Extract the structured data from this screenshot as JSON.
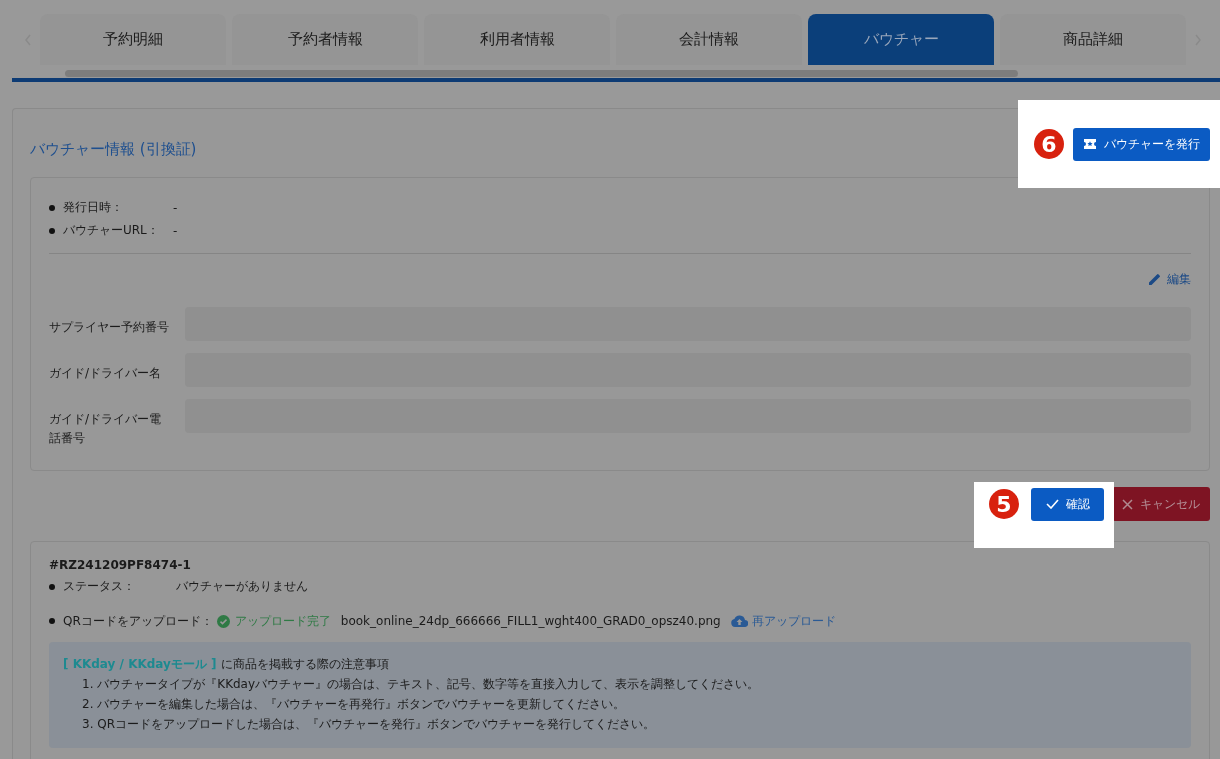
{
  "tabs": [
    {
      "label": "予約明細",
      "selected": false
    },
    {
      "label": "予約者情報",
      "selected": false
    },
    {
      "label": "利用者情報",
      "selected": false
    },
    {
      "label": "会計情報",
      "selected": false
    },
    {
      "label": "バウチャー",
      "selected": true
    },
    {
      "label": "商品詳細",
      "selected": false
    }
  ],
  "voucher_panel": {
    "title": "バウチャー情報 (引換証)",
    "issue_button": {
      "label": "バウチャーを発行",
      "callout": "6"
    },
    "info": [
      {
        "label": "発行日時：",
        "value": "-"
      },
      {
        "label": "バウチャーURL：",
        "value": "-"
      }
    ],
    "edit_link": "編集",
    "fields": [
      {
        "label": "サプライヤー予約番号"
      },
      {
        "label": "ガイド/ドライバー名"
      },
      {
        "label": "ガイド/ドライバー電話番号"
      }
    ],
    "confirm_button": {
      "label": "確認",
      "callout": "5"
    },
    "cancel_button": {
      "label": "キャンセル"
    }
  },
  "orders": [
    {
      "id": "#RZ241209PF8474-1",
      "status_label": "ステータス：",
      "status_value": "バウチャーがありません",
      "qr_label": "QRコードをアップロード：",
      "upload_state": "アップロード完了",
      "file": "book_online_24dp_666666_FILL1_wght400_GRAD0_opsz40.png",
      "reupload": "再アップロード",
      "notice": {
        "tag": "[ KKday / KKdayモール ]",
        "heading": "に商品を掲載する際の注意事項",
        "items": [
          "1. バウチャータイプが『KKdayバウチャー』の場合は、テキスト、記号、数字等を直接入力して、表示を調整してください。",
          "2. バウチャーを編集した場合は、『バウチャーを再発行』ボタンでバウチャーを更新してください。",
          "3. QRコードをアップロードした場合は、『バウチャーを発行』ボタンでバウチャーを発行してください。"
        ]
      }
    }
  ]
}
